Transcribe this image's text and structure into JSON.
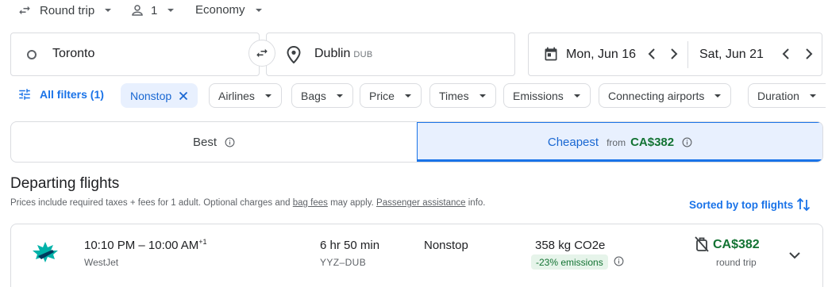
{
  "trip_options": {
    "trip_type": "Round trip",
    "passengers": "1",
    "cabin_class": "Economy"
  },
  "search": {
    "origin": "Toronto",
    "destination": "Dublin",
    "destination_code": "DUB",
    "depart_date": "Mon, Jun 16",
    "return_date": "Sat, Jun 21"
  },
  "filters": {
    "all_filters_label": "All filters (1)",
    "active_chip": "Nonstop",
    "chips": [
      "Airlines",
      "Bags",
      "Price",
      "Times",
      "Emissions",
      "Connecting airports",
      "Duration"
    ]
  },
  "sort_tabs": {
    "best_label": "Best",
    "cheapest_label": "Cheapest",
    "cheapest_from": "from",
    "cheapest_price": "CA$382"
  },
  "results": {
    "heading": "Departing flights",
    "notice_before": "Prices include required taxes + fees for 1 adult. Optional charges and ",
    "notice_link1": "bag fees",
    "notice_middle": " may apply. ",
    "notice_link2": "Passenger assistance",
    "notice_after": " info.",
    "sorted_label": "Sorted by top flights"
  },
  "flights": [
    {
      "times": "10:10 PM – 10:00 AM",
      "day_offset": "+1",
      "airline": "WestJet",
      "duration": "6 hr 50 min",
      "route": "YYZ–DUB",
      "stops": "Nonstop",
      "emissions": "358 kg CO2e",
      "emissions_badge": "-23% emissions",
      "price": "CA$382",
      "price_note": "round trip"
    }
  ],
  "colors": {
    "accent": "#1a73e8",
    "price_green": "#137333",
    "active_bg": "#e8f0fe",
    "airline_teal": "#00b2a9",
    "airline_navy": "#003a5d"
  },
  "icons": [
    "swap-arrows-icon",
    "person-icon",
    "chevron-down-icon",
    "circle-origin-icon",
    "location-pin-icon",
    "calendar-icon",
    "chevron-left-icon",
    "chevron-right-icon",
    "filter-sliders-icon",
    "close-icon",
    "info-icon",
    "sort-arrows-icon",
    "westjet-logo",
    "no-bags-icon"
  ]
}
